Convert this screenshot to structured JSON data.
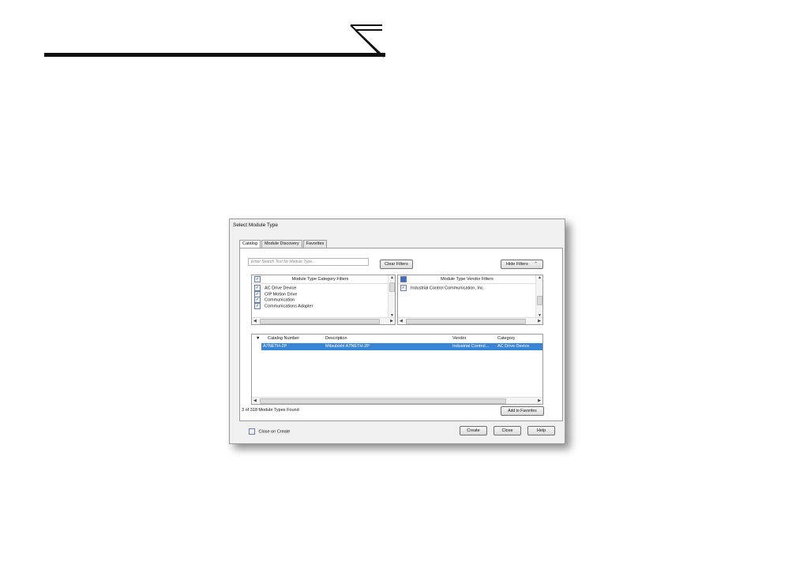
{
  "dialog": {
    "title": "Select Module Type",
    "tabs": [
      {
        "label": "Catalog",
        "active": true
      },
      {
        "label": "Module Discovery",
        "active": false
      },
      {
        "label": "Favorites",
        "active": false
      }
    ],
    "search_placeholder": "Enter Search Text for Module Type...",
    "clear_filters_label": "Clear Filters",
    "hide_filters_label": "Hide Filters",
    "hide_filters_icon": "double-chevron-up-icon",
    "category_filters": {
      "header": "Module Type Category Filters",
      "items": [
        {
          "label": "AC Drive Device",
          "checked": true
        },
        {
          "label": "CIP Motion Drive",
          "checked": true
        },
        {
          "label": "Communication",
          "checked": true
        },
        {
          "label": "Communications Adapter",
          "checked": true
        }
      ]
    },
    "vendor_filters": {
      "header": "Module Type Vendor Filters",
      "items": [
        {
          "label": "Industrial Control  Communication, Inc.",
          "checked": true
        }
      ]
    },
    "results": {
      "columns": [
        "Catalog Number",
        "Description",
        "Vendor",
        "Category"
      ],
      "rows": [
        {
          "catalog": "A7NETH-2P",
          "description": "Mitsubishi A7NETH-2P",
          "vendor": "Industrial Control...",
          "category": "AC Drive Device",
          "selected": true
        }
      ]
    },
    "count_text": "3  of 318 Module Types Found",
    "add_favorites_label": "Add to Favorites",
    "close_on_create_label": "Close on Create",
    "close_on_create_checked": false,
    "create_label": "Create",
    "close_label": "Close",
    "help_label": "Help",
    "selection_color": "#3a84d6"
  }
}
